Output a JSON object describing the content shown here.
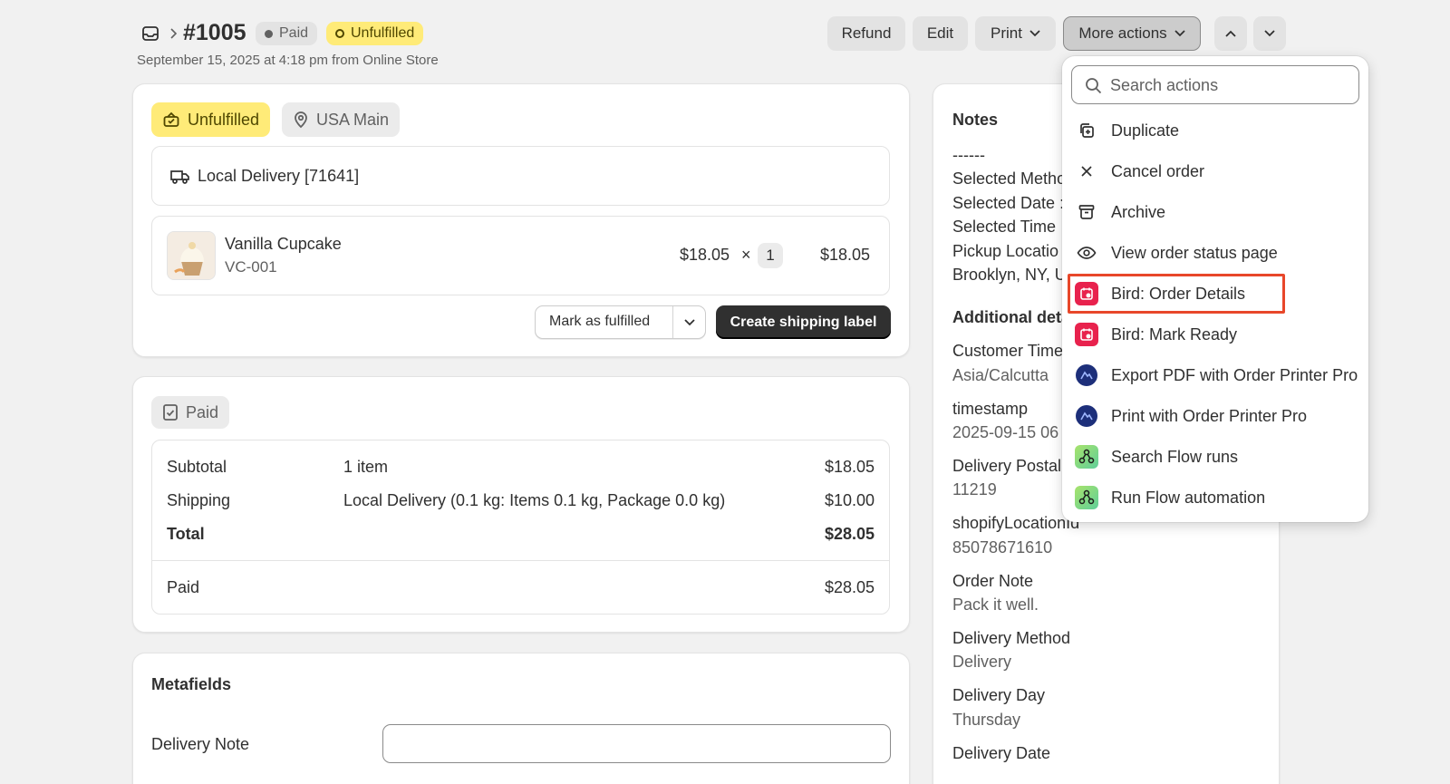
{
  "header": {
    "order_number": "#1005",
    "payment_badge": "Paid",
    "fulfillment_badge": "Unfulfilled",
    "subtitle": "September 15, 2025 at 4:18 pm from Online Store",
    "refund_label": "Refund",
    "edit_label": "Edit",
    "print_label": "Print",
    "more_actions_label": "More actions"
  },
  "fulfillment": {
    "status_label": "Unfulfilled",
    "location_label": "USA Main",
    "delivery_label": "Local Delivery [71641]",
    "item": {
      "name": "Vanilla Cupcake",
      "sku": "VC-001",
      "unit_price": "$18.05",
      "times": "×",
      "quantity": "1",
      "total": "$18.05"
    },
    "mark_fulfilled_label": "Mark as fulfilled",
    "create_label_label": "Create shipping label"
  },
  "payment": {
    "status_label": "Paid",
    "rows": [
      {
        "label": "Subtotal",
        "desc": "1 item",
        "amount": "$18.05"
      },
      {
        "label": "Shipping",
        "desc": "Local Delivery (0.1 kg: Items 0.1 kg, Package 0.0 kg)",
        "amount": "$10.00"
      },
      {
        "label": "Total",
        "desc": "",
        "amount": "$28.05"
      }
    ],
    "paid_label": "Paid",
    "paid_amount": "$28.05"
  },
  "metafields": {
    "title": "Metafields",
    "delivery_note_label": "Delivery Note",
    "delivery_note_value": ""
  },
  "notes": {
    "title": "Notes",
    "lines": [
      "------",
      "Selected Metho",
      "Selected Date :",
      "Selected Time",
      "Pickup Locatio",
      "Brooklyn, NY, U"
    ],
    "additional_title": "Additional deta",
    "details": [
      {
        "label": "Customer Time",
        "value": "Asia/Calcutta"
      },
      {
        "label": "timestamp",
        "value": "2025-09-15 06"
      },
      {
        "label": "Delivery Postal",
        "value": "11219"
      },
      {
        "label": "shopifyLocationId",
        "value": "85078671610"
      },
      {
        "label": "Order Note",
        "value": "Pack it well."
      },
      {
        "label": "Delivery Method",
        "value": "Delivery"
      },
      {
        "label": "Delivery Day",
        "value": "Thursday"
      },
      {
        "label": "Delivery Date",
        "value": ""
      }
    ]
  },
  "actions_menu": {
    "search_placeholder": "Search actions",
    "items": [
      {
        "label": "Duplicate",
        "icon": "duplicate-icon"
      },
      {
        "label": "Cancel order",
        "icon": "close-icon"
      },
      {
        "label": "Archive",
        "icon": "archive-icon"
      },
      {
        "label": "View order status page",
        "icon": "eye-icon"
      },
      {
        "label": "Bird: Order Details",
        "icon": "bird-app-icon"
      },
      {
        "label": "Bird: Mark Ready",
        "icon": "bird-app-icon"
      },
      {
        "label": "Export PDF with Order Printer Pro",
        "icon": "order-printer-icon"
      },
      {
        "label": "Print with Order Printer Pro",
        "icon": "order-printer-icon"
      },
      {
        "label": "Search Flow runs",
        "icon": "flow-icon"
      },
      {
        "label": "Run Flow automation",
        "icon": "flow-icon"
      }
    ],
    "highlighted_index": 4
  },
  "colors": {
    "unfulfilled_badge": "#ffeb78",
    "paid_badge": "#e3e3e3",
    "primary_button": "#303030",
    "highlight_outline": "#e8472a",
    "bird_app": "#e8224d",
    "order_printer_app": "#1d2f7a"
  }
}
